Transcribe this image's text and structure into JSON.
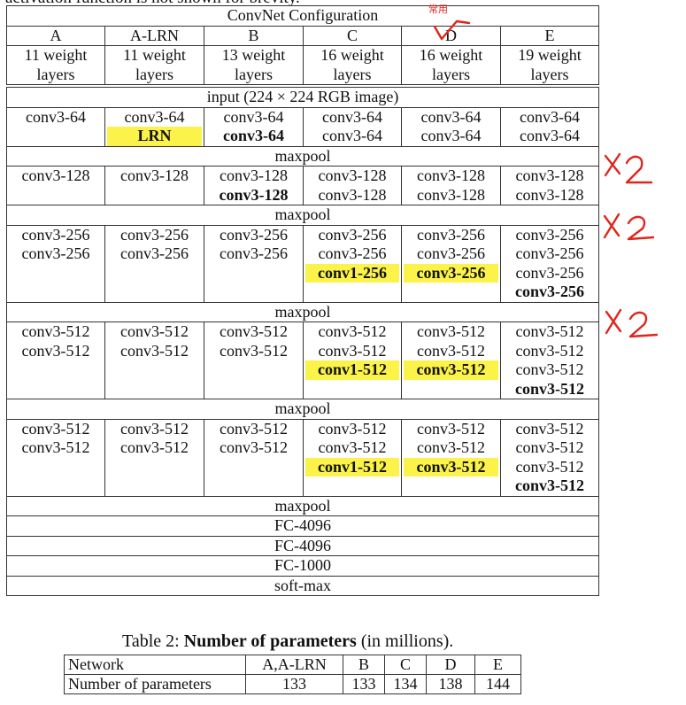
{
  "top_cut_text": "activation function is not shown for brevity.",
  "config": {
    "title": "ConvNet Configuration",
    "columns": [
      "A",
      "A-LRN",
      "B",
      "C",
      "D",
      "E"
    ],
    "depths": [
      [
        "11 weight",
        "layers"
      ],
      [
        "11 weight",
        "layers"
      ],
      [
        "13 weight",
        "layers"
      ],
      [
        "16 weight",
        "layers"
      ],
      [
        "16 weight",
        "layers"
      ],
      [
        "19 weight",
        "layers"
      ]
    ],
    "input_label": "input (224 × 224 RGB image)",
    "block1": [
      [
        {
          "t": "conv3-64"
        }
      ],
      [
        {
          "t": "conv3-64"
        },
        {
          "t": "LRN",
          "b": true,
          "h": true
        }
      ],
      [
        {
          "t": "conv3-64"
        },
        {
          "t": "conv3-64",
          "b": true
        }
      ],
      [
        {
          "t": "conv3-64"
        },
        {
          "t": "conv3-64"
        }
      ],
      [
        {
          "t": "conv3-64"
        },
        {
          "t": "conv3-64"
        }
      ],
      [
        {
          "t": "conv3-64"
        },
        {
          "t": "conv3-64"
        }
      ]
    ],
    "maxpool1": "maxpool",
    "block2": [
      [
        {
          "t": "conv3-128"
        }
      ],
      [
        {
          "t": "conv3-128"
        }
      ],
      [
        {
          "t": "conv3-128"
        },
        {
          "t": "conv3-128",
          "b": true
        }
      ],
      [
        {
          "t": "conv3-128"
        },
        {
          "t": "conv3-128"
        }
      ],
      [
        {
          "t": "conv3-128"
        },
        {
          "t": "conv3-128"
        }
      ],
      [
        {
          "t": "conv3-128"
        },
        {
          "t": "conv3-128"
        }
      ]
    ],
    "maxpool2": "maxpool",
    "block3": [
      [
        {
          "t": "conv3-256"
        },
        {
          "t": "conv3-256"
        }
      ],
      [
        {
          "t": "conv3-256"
        },
        {
          "t": "conv3-256"
        }
      ],
      [
        {
          "t": "conv3-256"
        },
        {
          "t": "conv3-256"
        }
      ],
      [
        {
          "t": "conv3-256"
        },
        {
          "t": "conv3-256"
        },
        {
          "t": "conv1-256",
          "b": true,
          "h": true
        }
      ],
      [
        {
          "t": "conv3-256"
        },
        {
          "t": "conv3-256"
        },
        {
          "t": "conv3-256",
          "b": true,
          "h": true
        }
      ],
      [
        {
          "t": "conv3-256"
        },
        {
          "t": "conv3-256"
        },
        {
          "t": "conv3-256"
        },
        {
          "t": "conv3-256",
          "b": true
        }
      ]
    ],
    "maxpool3": "maxpool",
    "block4": [
      [
        {
          "t": "conv3-512"
        },
        {
          "t": "conv3-512"
        }
      ],
      [
        {
          "t": "conv3-512"
        },
        {
          "t": "conv3-512"
        }
      ],
      [
        {
          "t": "conv3-512"
        },
        {
          "t": "conv3-512"
        }
      ],
      [
        {
          "t": "conv3-512"
        },
        {
          "t": "conv3-512"
        },
        {
          "t": "conv1-512",
          "b": true,
          "h": true
        }
      ],
      [
        {
          "t": "conv3-512"
        },
        {
          "t": "conv3-512"
        },
        {
          "t": "conv3-512",
          "b": true,
          "h": true
        }
      ],
      [
        {
          "t": "conv3-512"
        },
        {
          "t": "conv3-512"
        },
        {
          "t": "conv3-512"
        },
        {
          "t": "conv3-512",
          "b": true
        }
      ]
    ],
    "maxpool4": "maxpool",
    "block5": [
      [
        {
          "t": "conv3-512"
        },
        {
          "t": "conv3-512"
        }
      ],
      [
        {
          "t": "conv3-512"
        },
        {
          "t": "conv3-512"
        }
      ],
      [
        {
          "t": "conv3-512"
        },
        {
          "t": "conv3-512"
        }
      ],
      [
        {
          "t": "conv3-512"
        },
        {
          "t": "conv3-512"
        },
        {
          "t": "conv1-512",
          "b": true,
          "h": true
        }
      ],
      [
        {
          "t": "conv3-512"
        },
        {
          "t": "conv3-512"
        },
        {
          "t": "conv3-512",
          "b": true,
          "h": true
        }
      ],
      [
        {
          "t": "conv3-512"
        },
        {
          "t": "conv3-512"
        },
        {
          "t": "conv3-512"
        },
        {
          "t": "conv3-512",
          "b": true
        }
      ]
    ],
    "tail": [
      "maxpool",
      "FC-4096",
      "FC-4096",
      "FC-1000",
      "soft-max"
    ]
  },
  "table2": {
    "caption_prefix": "Table 2: ",
    "caption_bold": "Number of parameters",
    "caption_suffix": " (in millions).",
    "header": [
      "Network",
      "A,A-LRN",
      "B",
      "C",
      "D",
      "E"
    ],
    "row_label": "Number of parameters",
    "values": [
      "133",
      "133",
      "134",
      "138",
      "144"
    ]
  },
  "annotations": {
    "note_common": "常用",
    "mark_x2_a": "×2",
    "mark_x2_b": "×2",
    "mark_x2_c": "×2"
  },
  "colors": {
    "highlight": "#fbf24a",
    "annotation": "#e0251b",
    "border": "#333333"
  }
}
